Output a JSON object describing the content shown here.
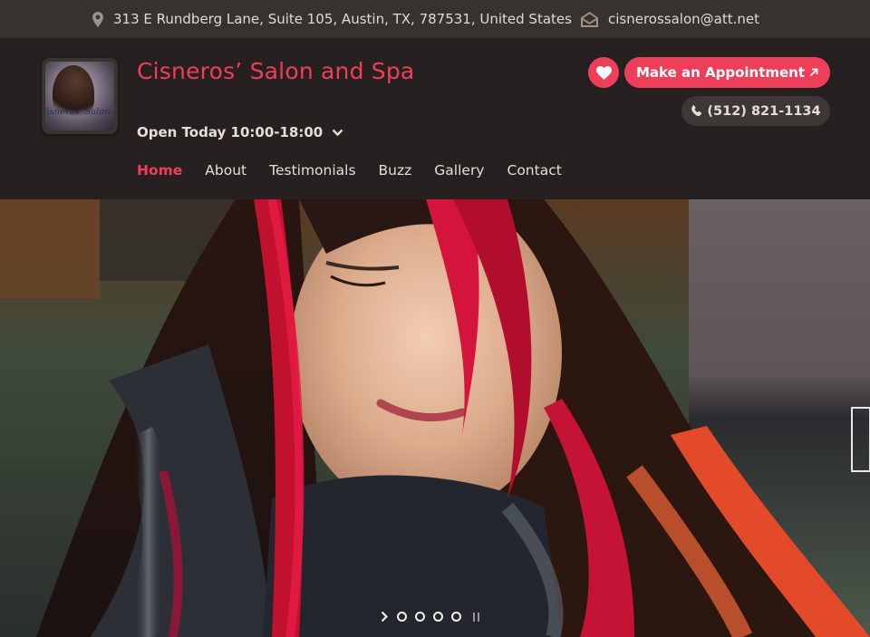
{
  "topbar": {
    "address": "313 E Rundberg Lane, Suite 105, Austin, TX, 787531, United States",
    "email": "cisnerossalon@att.net",
    "address_icon": "map-pin-icon",
    "email_icon": "envelope-icon"
  },
  "header": {
    "title": "Cisneros’ Salon and Spa",
    "logo_text": "Cisneros' Salon & Spa",
    "hours": "Open Today 10:00-18:00",
    "appointment_label": "Make an Appointment",
    "phone": "(512) 821-1134"
  },
  "nav": {
    "items": [
      {
        "label": "Home"
      },
      {
        "label": "About"
      },
      {
        "label": "Testimonials"
      },
      {
        "label": "Buzz"
      },
      {
        "label": "Gallery"
      },
      {
        "label": "Contact"
      }
    ]
  },
  "hero": {
    "slide_count": 4,
    "active_slide": 1
  },
  "colors": {
    "accent": "#ee3f5a",
    "topbar_bg": "#38322f",
    "header_bg": "#262120"
  }
}
